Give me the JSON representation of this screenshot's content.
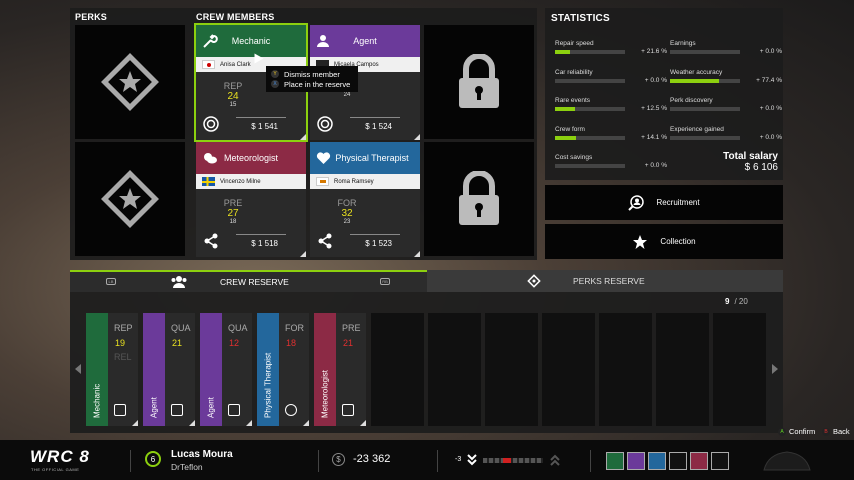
{
  "sections": {
    "perks": "PERKS",
    "crew_members": "CREW MEMBERS",
    "statistics": "STATISTICS"
  },
  "crew": [
    {
      "role": "Mechanic",
      "name": "Anisa Clark",
      "stat_key": "REP",
      "stat_value": "24",
      "stat_sub": "15",
      "salary": "$ 1 541",
      "color": "#1f6b3c",
      "selected": true
    },
    {
      "role": "Agent",
      "name": "Micaela Campos",
      "stat_key": "",
      "stat_value": "33",
      "stat_sub": "24",
      "salary": "$ 1 524",
      "color": "#6b3a9a"
    },
    {
      "role": "Meteorologist",
      "name": "Vincenzo Milne",
      "stat_key": "PRE",
      "stat_value": "27",
      "stat_sub": "18",
      "salary": "$ 1 518",
      "color": "#8c2a45"
    },
    {
      "role": "Physical Therapist",
      "name": "Roma Ramsey",
      "stat_key": "FOR",
      "stat_value": "32",
      "stat_sub": "23",
      "salary": "$ 1 523",
      "color": "#23679c"
    }
  ],
  "context_menu": {
    "dismiss": "Dismiss member",
    "reserve": "Place in the reserve",
    "dismiss_key": "Y",
    "reserve_key": "X"
  },
  "statistics": {
    "left": [
      {
        "label": "Repair speed",
        "value": "+ 21.6 %",
        "fill": 0.22
      },
      {
        "label": "Car reliability",
        "value": "+ 0.0 %",
        "fill": 0
      },
      {
        "label": "Rare events",
        "value": "+ 12.5 %",
        "fill": 0.28
      },
      {
        "label": "Crew form",
        "value": "+ 14.1 %",
        "fill": 0.3
      },
      {
        "label": "Cost savings",
        "value": "+ 0.0 %",
        "fill": 0
      }
    ],
    "right": [
      {
        "label": "Earnings",
        "value": "+ 0.0 %",
        "fill": 0
      },
      {
        "label": "Weather accuracy",
        "value": "+ 77.4 %",
        "fill": 0.7
      },
      {
        "label": "Perk discovery",
        "value": "+ 0.0 %",
        "fill": 0
      },
      {
        "label": "Experience gained",
        "value": "+ 0.0 %",
        "fill": 0
      }
    ],
    "total_label": "Total salary",
    "total_value": "$ 6 106"
  },
  "buttons": {
    "recruitment": "Recruitment",
    "collection": "Collection"
  },
  "tabs": {
    "crew_reserve": "CREW RESERVE",
    "perks_reserve": "PERKS RESERVE",
    "lb": "LB",
    "rb": "RB"
  },
  "reserve_count": {
    "current": "9",
    "total": "/ 20"
  },
  "reserve": [
    {
      "role": "Mechanic",
      "k1": "REP",
      "v1": "19",
      "k2": "REL",
      "color": "#1f6b3c",
      "vcolor": "#e8e020"
    },
    {
      "role": "Agent",
      "k1": "QUA",
      "v1": "21",
      "color": "#6b3a9a",
      "vcolor": "#e8e020"
    },
    {
      "role": "Agent",
      "k1": "QUA",
      "v1": "12",
      "color": "#6b3a9a",
      "vcolor": "#e03030"
    },
    {
      "role": "Physical Therapist",
      "k1": "FOR",
      "v1": "18",
      "color": "#23679c",
      "vcolor": "#e03030"
    },
    {
      "role": "Meteorologist",
      "k1": "PRE",
      "v1": "21",
      "color": "#8c2a45",
      "vcolor": "#e03030"
    }
  ],
  "bottom": {
    "brand": "WRC 8",
    "brand_sub": "THE OFFICIAL GAME",
    "level": "6",
    "player": "Lucas Moura",
    "team": "DrTeflon",
    "money": "-23 362",
    "rank": "-3",
    "confirm": "Confirm",
    "back": "Back",
    "confirm_key": "A",
    "back_key": "B"
  },
  "colors": {
    "accent": "#8cd00f",
    "background": "#1a1a1a"
  }
}
